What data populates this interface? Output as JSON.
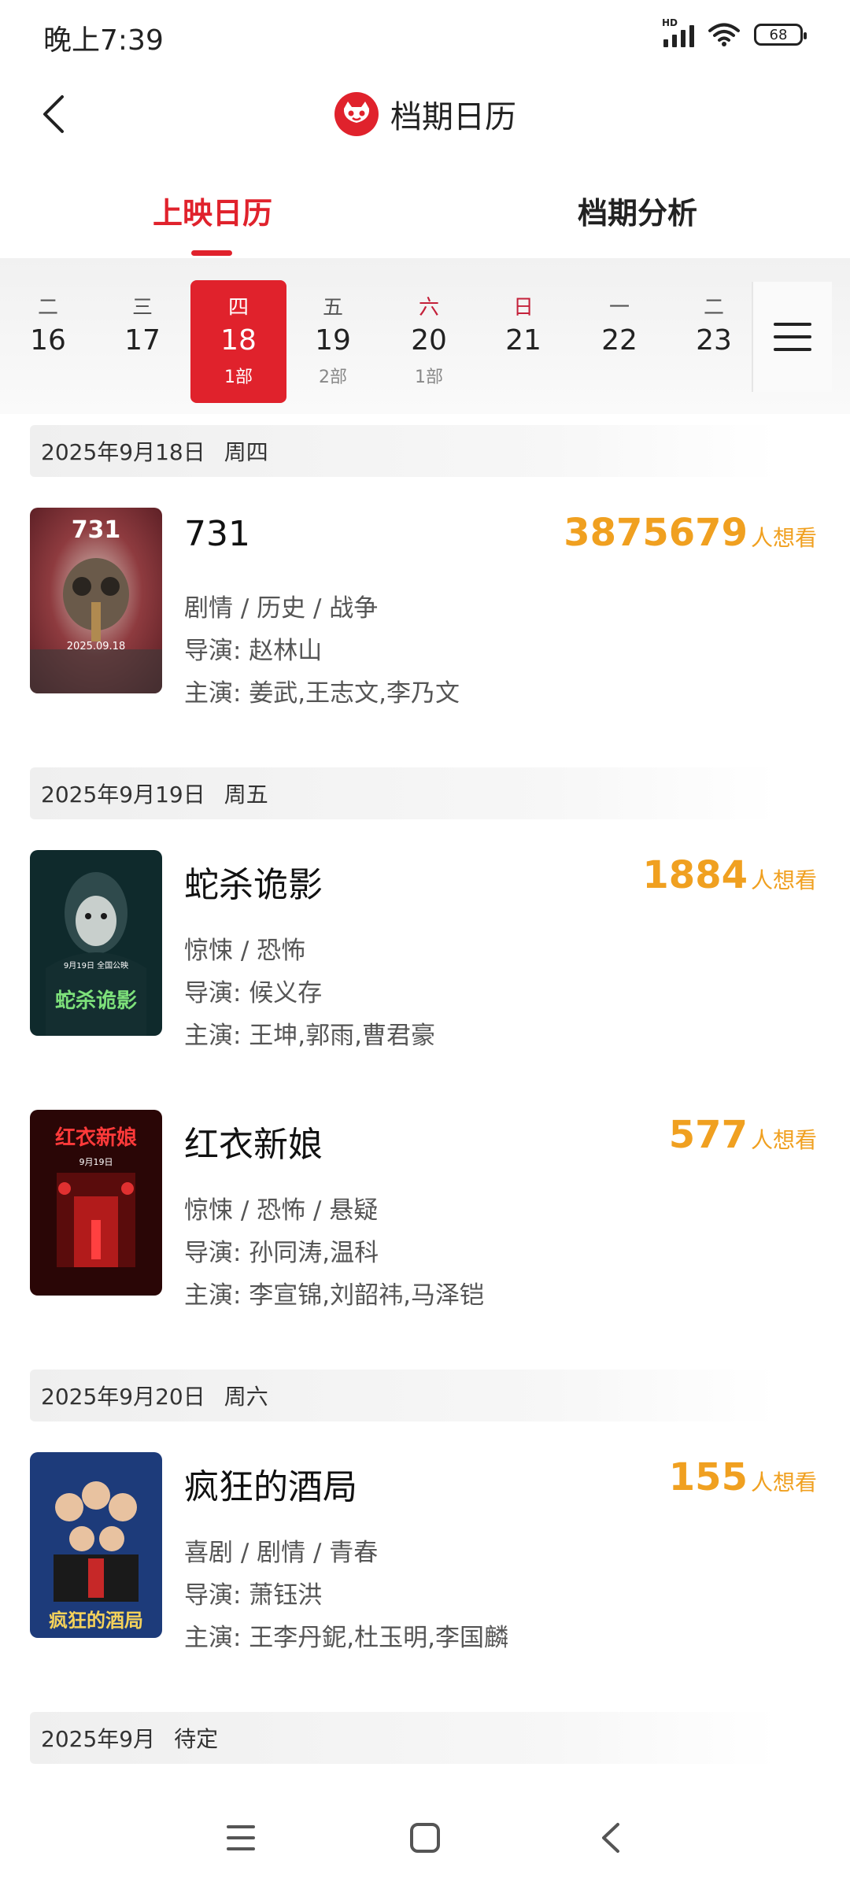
{
  "status": {
    "time": "晚上7:39",
    "network": "HD",
    "battery": "68"
  },
  "header": {
    "title": "档期日历"
  },
  "tabs": [
    "上映日历",
    "档期分析"
  ],
  "dates": [
    {
      "weekday": "二",
      "day": "16",
      "count": ""
    },
    {
      "weekday": "三",
      "day": "17",
      "count": ""
    },
    {
      "weekday": "四",
      "day": "18",
      "count": "1部"
    },
    {
      "weekday": "五",
      "day": "19",
      "count": "2部"
    },
    {
      "weekday": "六",
      "day": "20",
      "count": "1部"
    },
    {
      "weekday": "日",
      "day": "21",
      "count": ""
    },
    {
      "weekday": "一",
      "day": "22",
      "count": ""
    },
    {
      "weekday": "二",
      "day": "23",
      "count": ""
    }
  ],
  "sections": [
    {
      "date": "2025年9月18日",
      "weekday": "周四"
    },
    {
      "date": "2025年9月19日",
      "weekday": "周五"
    },
    {
      "date": "2025年9月20日",
      "weekday": "周六"
    },
    {
      "date": "2025年9月",
      "weekday": "待定"
    }
  ],
  "want_unit": "人想看",
  "movies": [
    {
      "title": "731",
      "want": "3875679",
      "genres": "剧情 / 历史 / 战争",
      "director": "导演: 赵林山",
      "cast": "主演: 姜武,王志文,李乃文",
      "poster_text": "731",
      "poster_sub": "2025.09.18"
    },
    {
      "title": "蛇杀诡影",
      "want": "1884",
      "genres": "惊悚 / 恐怖",
      "director": "导演: 候义存",
      "cast": "主演: 王坤,郭雨,曹君豪",
      "poster_text": "蛇杀诡影",
      "poster_sub": "9月19日 全国公映"
    },
    {
      "title": "红衣新娘",
      "want": "577",
      "genres": "惊悚 / 恐怖 / 悬疑",
      "director": "导演: 孙同涛,温科",
      "cast": "主演: 李宣锦,刘韶祎,马泽铠",
      "poster_text": "红衣新娘",
      "poster_sub": "9月19日"
    },
    {
      "title": "疯狂的酒局",
      "want": "155",
      "genres": "喜剧 / 剧情 / 青春",
      "director": "导演: 萧钰洪",
      "cast": "主演: 王李丹鈮,杜玉明,李国麟",
      "poster_text": "疯狂的酒局",
      "poster_sub": ""
    }
  ],
  "colors": {
    "accent": "#e0222c",
    "want": "#f0a020"
  }
}
